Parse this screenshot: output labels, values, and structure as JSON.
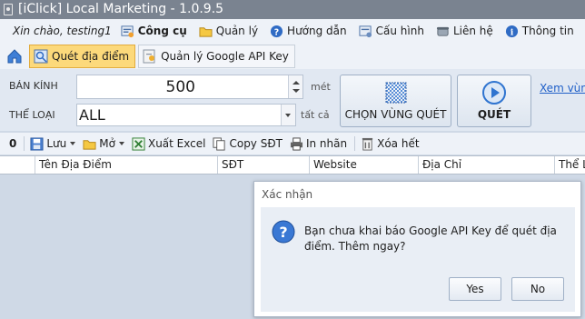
{
  "window": {
    "title": "[iClick] Local Marketing - 1.0.9.5"
  },
  "menubar": {
    "greeting": "Xin chào, testing1",
    "items": [
      {
        "label": "Công cụ",
        "icon": "tools-icon"
      },
      {
        "label": "Quản lý",
        "icon": "folder-icon"
      },
      {
        "label": "Hướng dẫn",
        "icon": "help-icon"
      },
      {
        "label": "Cấu hình",
        "icon": "settings-icon"
      },
      {
        "label": "Liên hệ",
        "icon": "phone-icon"
      },
      {
        "label": "Thông tin",
        "icon": "info-icon"
      }
    ]
  },
  "tabs": [
    {
      "label": "Quét địa điểm",
      "active": true
    },
    {
      "label": "Quản lý Google API Key",
      "active": false
    }
  ],
  "form": {
    "radius_label": "BÁN KÍNH",
    "radius_value": "500",
    "radius_unit": "mét",
    "category_label": "THỂ LOẠI",
    "category_value": "ALL",
    "category_all": "tất cả",
    "select_area_label": "CHỌN VÙNG QUÉT",
    "scan_label": "QUÉT",
    "view_link": "Xem vùng"
  },
  "toolbar": {
    "count": "0",
    "save": "Lưu",
    "open": "Mở",
    "export_excel": "Xuất Excel",
    "copy_phone": "Copy SĐT",
    "print_label": "In nhãn",
    "clear_all": "Xóa hết"
  },
  "grid": {
    "columns": [
      "Tên Địa Điểm",
      "SĐT",
      "Website",
      "Địa Chỉ",
      "Thể L"
    ]
  },
  "dialog": {
    "title": "Xác nhận",
    "message": "Bạn chưa khai báo Google API Key để quét địa điểm. Thêm ngay?",
    "yes": "Yes",
    "no": "No"
  },
  "colors": {
    "accent": "#fcd97b",
    "titlebar": "#7a8390",
    "link": "#1f5fc8",
    "scan_circle": "#2f74d0"
  }
}
